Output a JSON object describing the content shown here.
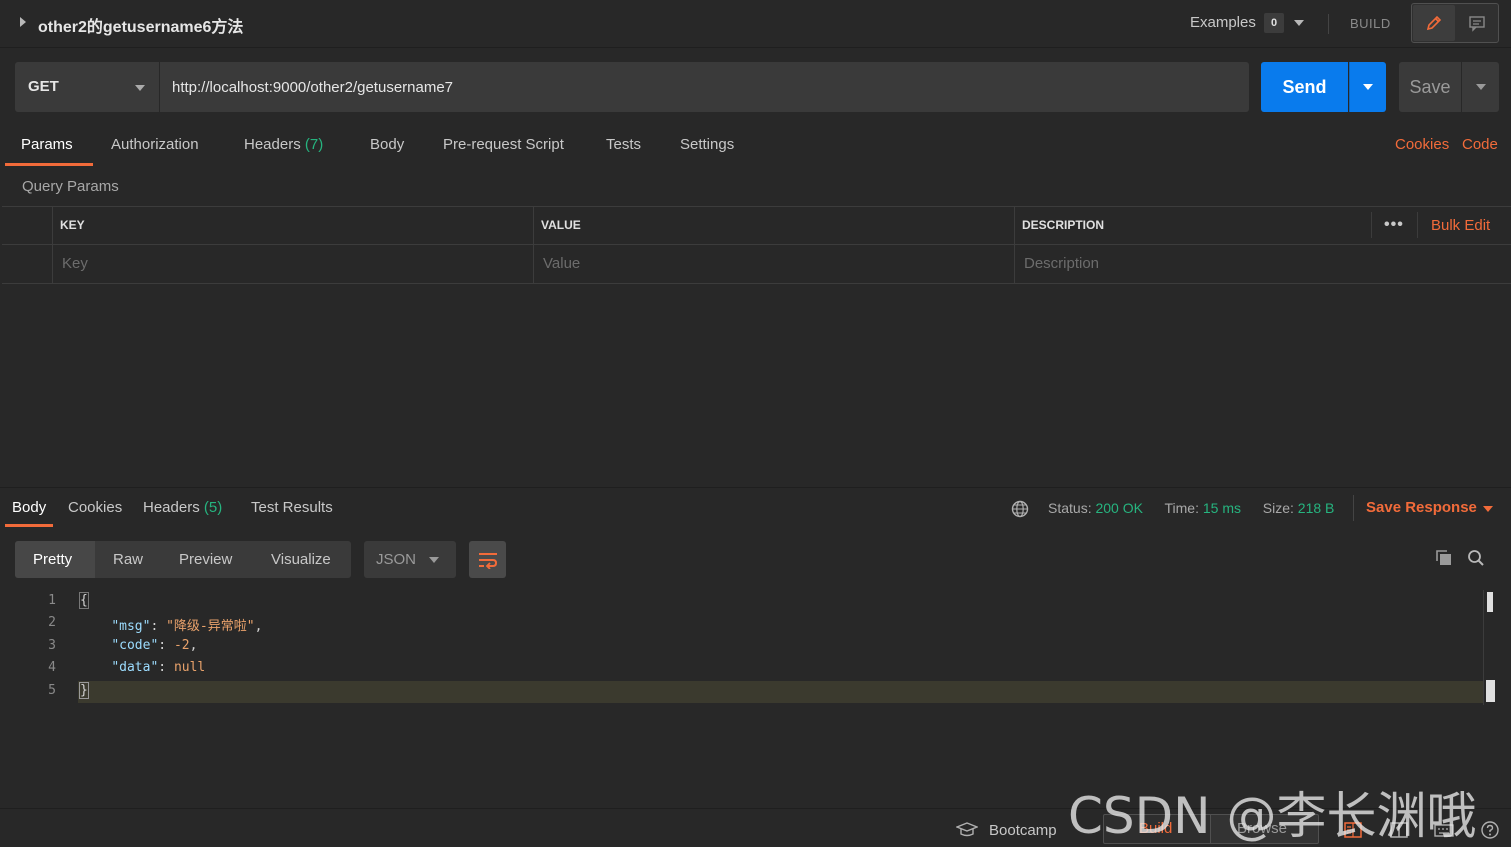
{
  "header": {
    "request_title": "other2的getusername6方法",
    "examples_label": "Examples",
    "examples_count": "0",
    "build_label": "BUILD"
  },
  "request": {
    "method": "GET",
    "url": "http://localhost:9000/other2/getusername7",
    "send_label": "Send",
    "save_label": "Save"
  },
  "request_tabs": {
    "params": "Params",
    "authorization": "Authorization",
    "headers": "Headers",
    "headers_count": "(7)",
    "body": "Body",
    "pre_request_script": "Pre-request Script",
    "tests": "Tests",
    "settings": "Settings",
    "cookies_link": "Cookies",
    "code_link": "Code"
  },
  "query_params": {
    "title": "Query Params",
    "columns": {
      "key": "KEY",
      "value": "VALUE",
      "description": "DESCRIPTION"
    },
    "placeholders": {
      "key": "Key",
      "value": "Value",
      "description": "Description"
    },
    "bulk_edit": "Bulk Edit",
    "more": "•••"
  },
  "response": {
    "tabs": {
      "body": "Body",
      "cookies": "Cookies",
      "headers": "Headers",
      "headers_count": "(5)",
      "test_results": "Test Results"
    },
    "status_label": "Status:",
    "status_value": "200 OK",
    "time_label": "Time:",
    "time_value": "15 ms",
    "size_label": "Size:",
    "size_value": "218 B",
    "save_response": "Save Response",
    "views": {
      "pretty": "Pretty",
      "raw": "Raw",
      "preview": "Preview",
      "visualize": "Visualize"
    },
    "format": "JSON",
    "code": {
      "line_numbers": [
        "1",
        "2",
        "3",
        "4",
        "5"
      ],
      "open_brace": "{",
      "close_brace": "}",
      "msg_key": "\"msg\"",
      "msg_value": "\"降级-异常啦\"",
      "code_key": "\"code\"",
      "code_value": "-2",
      "data_key": "\"data\"",
      "data_value": "null"
    }
  },
  "footer": {
    "bootcamp": "Bootcamp",
    "build": "Build",
    "browse": "Browse"
  },
  "watermark": "CSDN @李长渊哦",
  "colors": {
    "accent": "#f26b3a",
    "send_blue": "#097bed",
    "success_green": "#26b47f",
    "background": "#282828"
  },
  "icons": [
    "pencil-icon",
    "comment-icon",
    "globe-icon",
    "copy-icon",
    "search-icon",
    "wrap-lines-icon",
    "bootcamp-icon",
    "layout-icon"
  ]
}
